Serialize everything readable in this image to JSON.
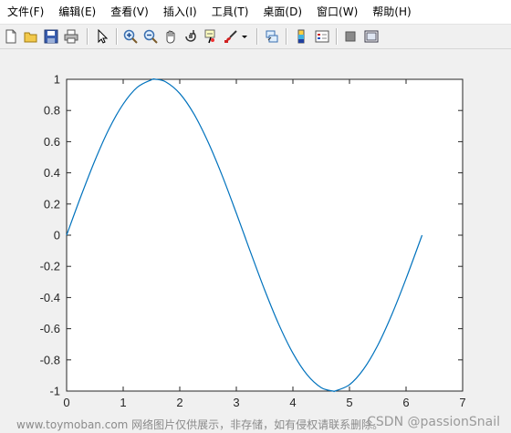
{
  "menu": {
    "items": [
      {
        "label": "文件(F)"
      },
      {
        "label": "编辑(E)"
      },
      {
        "label": "查看(V)"
      },
      {
        "label": "插入(I)"
      },
      {
        "label": "工具(T)"
      },
      {
        "label": "桌面(D)"
      },
      {
        "label": "窗口(W)"
      },
      {
        "label": "帮助(H)"
      }
    ]
  },
  "toolbar": {
    "icons": [
      "new-figure-icon",
      "open-file-icon",
      "save-icon",
      "print-icon",
      "pointer-icon",
      "zoom-in-icon",
      "zoom-out-icon",
      "pan-icon",
      "rotate-3d-icon",
      "data-cursor-icon",
      "brush-icon",
      "brush-dropdown-icon",
      "link-plot-icon",
      "colorbar-icon",
      "legend-icon",
      "hide-plot-tools-icon",
      "show-plot-tools-icon"
    ]
  },
  "colors": {
    "line": "#0072bd",
    "axes_bg": "#ffffff",
    "figure_bg": "#f0f0f0",
    "axis": "#262626"
  },
  "chart_data": {
    "type": "line",
    "title": "",
    "xlabel": "",
    "ylabel": "",
    "xlim": [
      0,
      7
    ],
    "ylim": [
      -1,
      1
    ],
    "xticks": [
      0,
      1,
      2,
      3,
      4,
      5,
      6,
      7
    ],
    "yticks": [
      -1,
      -0.8,
      -0.6,
      -0.4,
      -0.2,
      0,
      0.2,
      0.4,
      0.6,
      0.8,
      1
    ],
    "ytick_labels": [
      "-1",
      "-0.8",
      "-0.6",
      "-0.4",
      "-0.2",
      "0",
      "0.2",
      "0.4",
      "0.6",
      "0.8",
      "1"
    ],
    "grid": false,
    "series": [
      {
        "x": [
          0,
          0.25,
          0.5,
          0.75,
          1.0,
          1.25,
          1.5,
          1.571,
          1.75,
          2.0,
          2.25,
          2.5,
          2.75,
          3.0,
          3.142,
          3.25,
          3.5,
          3.75,
          4.0,
          4.25,
          4.5,
          4.712,
          4.75,
          5.0,
          5.25,
          5.5,
          5.75,
          6.0,
          6.283
        ],
        "y": [
          0,
          0.247,
          0.479,
          0.682,
          0.841,
          0.949,
          0.997,
          1.0,
          0.984,
          0.909,
          0.778,
          0.598,
          0.382,
          0.141,
          0.0,
          -0.108,
          -0.351,
          -0.572,
          -0.757,
          -0.895,
          -0.978,
          -1.0,
          -0.999,
          -0.959,
          -0.859,
          -0.706,
          -0.508,
          -0.279,
          0.0
        ]
      }
    ]
  },
  "watermark": {
    "left": "www.toymoban.com 网络图片仅供展示，非存储，如有侵权请联系删除。",
    "right": "CSDN @passionSnail"
  }
}
